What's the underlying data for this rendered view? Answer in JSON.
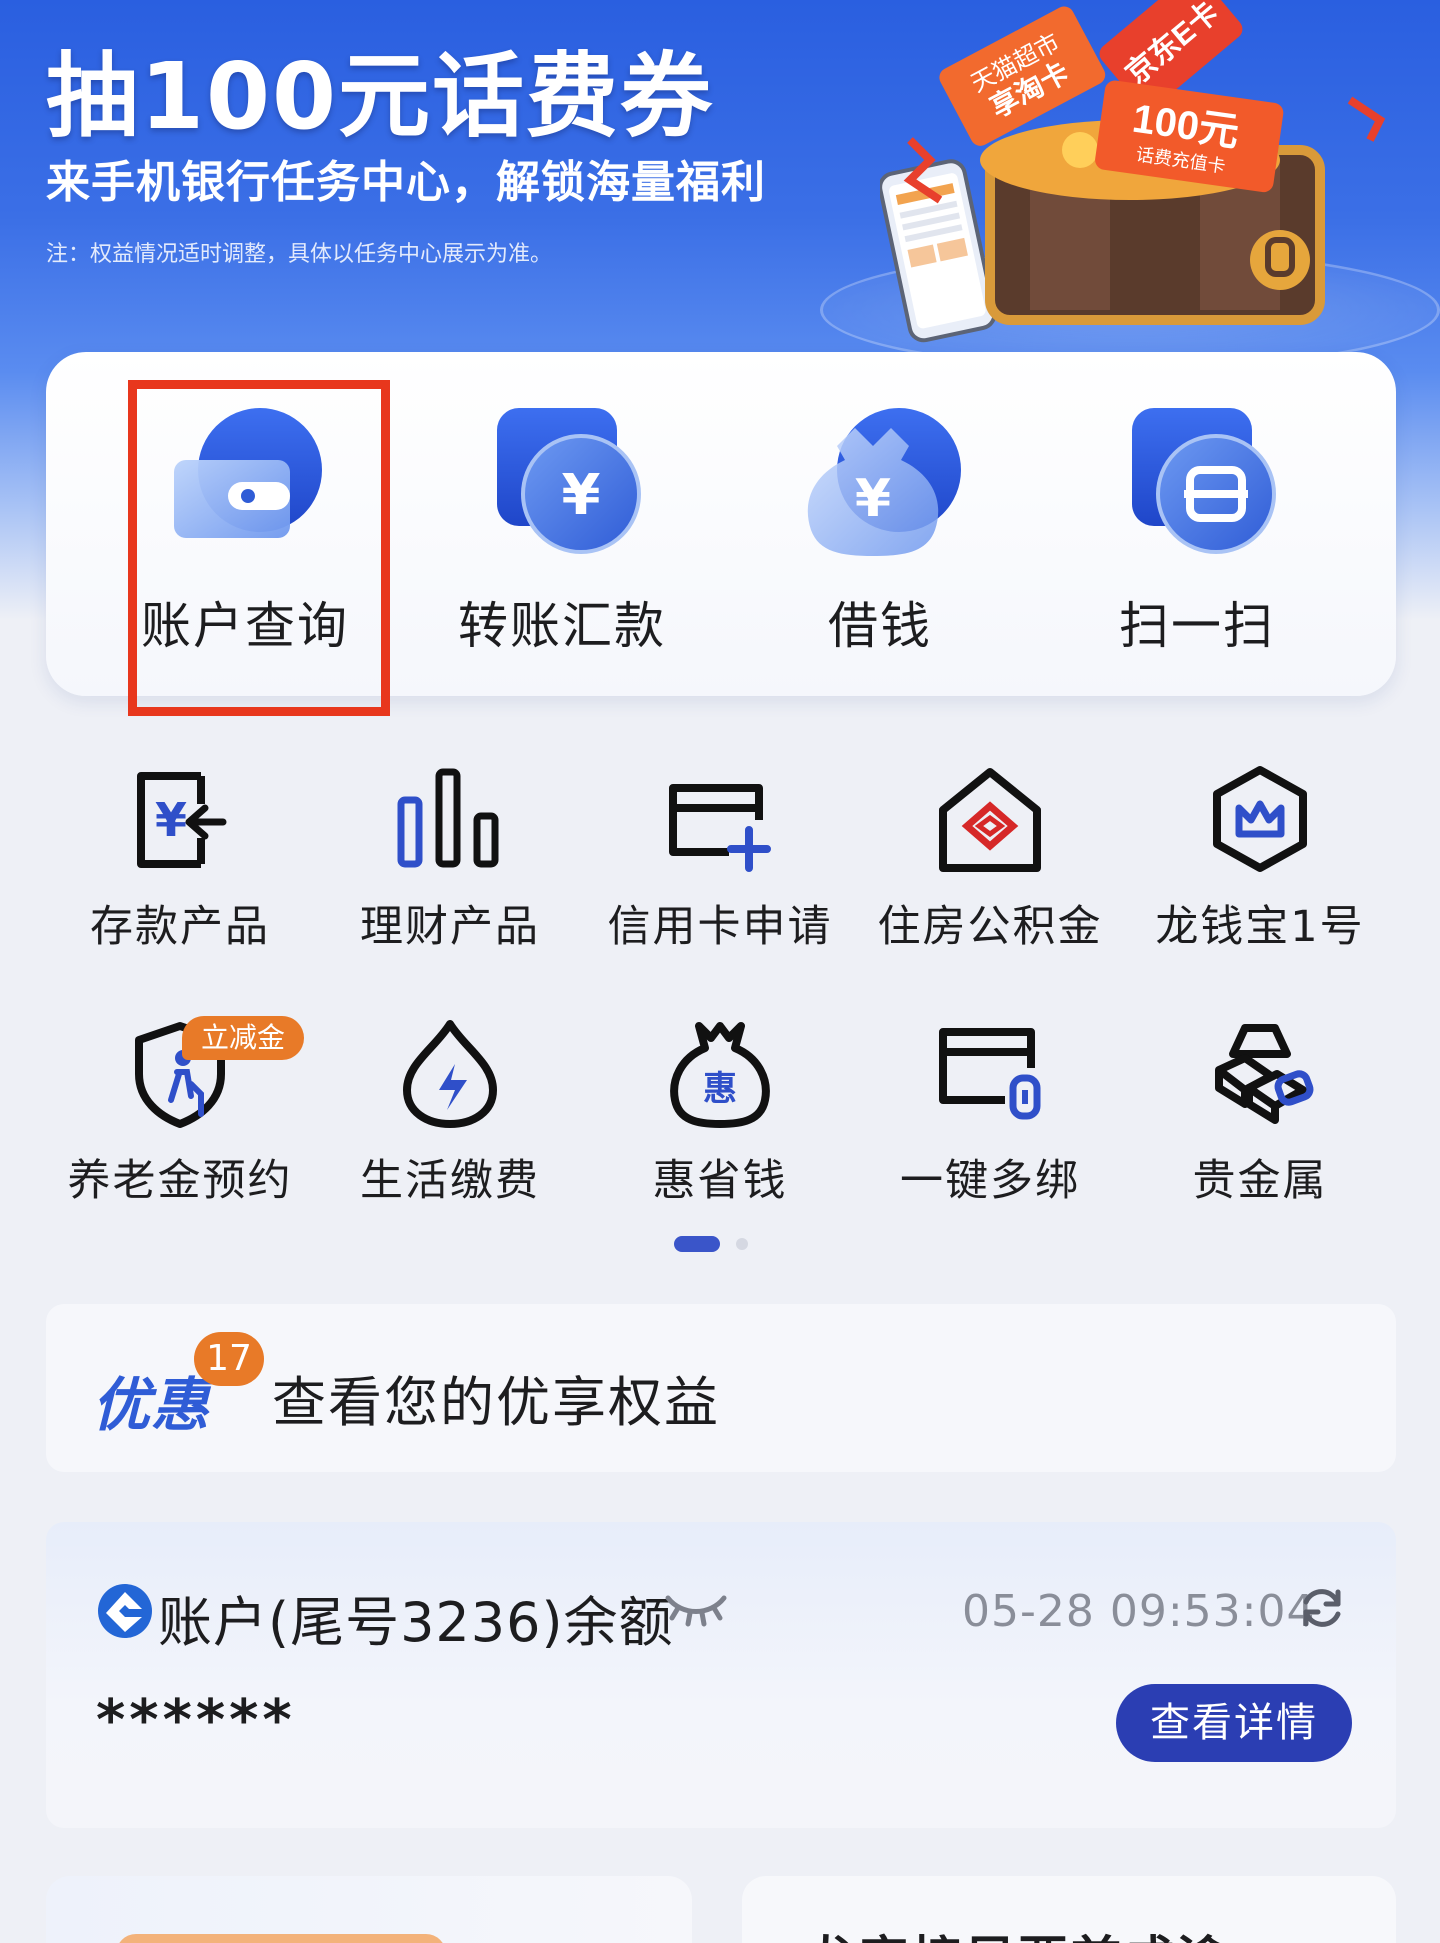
{
  "banner": {
    "title": "抽100元话费券",
    "subtitle": "来手机银行任务中心，解锁海量福利",
    "note": "注：权益情况适时调整，具体以任务中心展示为准。",
    "ticket_1": "天猫超市享淘卡",
    "ticket_2": "京东E卡",
    "coupon_value": "100元",
    "coupon_sub": "话费充值卡"
  },
  "quick": {
    "items": [
      {
        "label": "账户查询",
        "icon": "wallet-icon"
      },
      {
        "label": "转账汇款",
        "icon": "transfer-yen-icon"
      },
      {
        "label": "借钱",
        "icon": "money-bag-icon"
      },
      {
        "label": "扫一扫",
        "icon": "scan-icon"
      }
    ]
  },
  "grid": {
    "row1": [
      {
        "label": "存款产品",
        "icon": "deposit-icon"
      },
      {
        "label": "理财产品",
        "icon": "bar-chart-icon"
      },
      {
        "label": "信用卡申请",
        "icon": "credit-card-add-icon"
      },
      {
        "label": "住房公积金",
        "icon": "house-icon"
      },
      {
        "label": "龙钱宝1号",
        "icon": "crown-hexagon-icon"
      }
    ],
    "row2": [
      {
        "label": "养老金预约",
        "icon": "shield-elder-icon"
      },
      {
        "label": "生活缴费",
        "icon": "lightning-drop-icon"
      },
      {
        "label": "惠省钱",
        "icon": "hui-bag-icon"
      },
      {
        "label": "一键多绑",
        "icon": "card-link-icon"
      },
      {
        "label": "贵金属",
        "icon": "gold-bars-icon"
      }
    ],
    "tag": "立减金"
  },
  "promo": {
    "logo": "优惠",
    "count": "17",
    "text": "查看您的优享权益"
  },
  "account": {
    "title": "账户(尾号3236)余额",
    "time": "05-28 09:53:04",
    "balance": "******",
    "detail_button": "查看详情"
  },
  "bottom": {
    "right_peek_text": "龙字接早要首成渝"
  },
  "colors": {
    "brand_blue": "#2b3eb3",
    "banner_blue": "#2a5fe0",
    "highlight_red": "#e8371d",
    "badge_orange": "#e87a28"
  }
}
